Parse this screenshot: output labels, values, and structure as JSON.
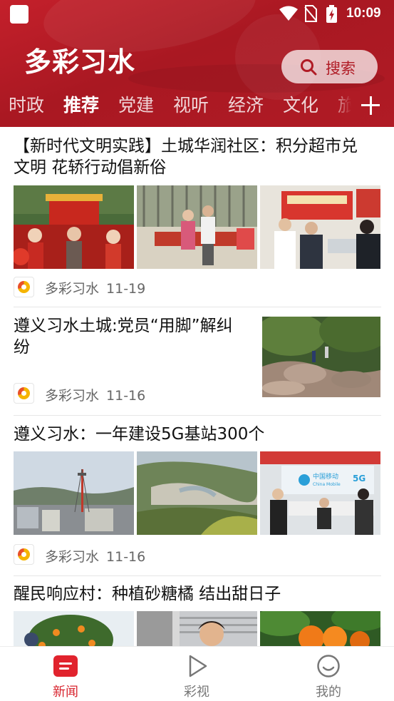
{
  "status_bar": {
    "time": "10:09"
  },
  "header": {
    "app_title": "多彩习水",
    "search_label": "搜索",
    "tabs": [
      "时政",
      "推荐",
      "党建",
      "视听",
      "经济",
      "文化",
      "旅"
    ],
    "active_tab": "推荐"
  },
  "articles": [
    {
      "title_line1": "【新时代文明实践】土城华润社区：积分超市兑",
      "title_line2": "文明 花轿行动倡新俗",
      "source": "多彩习水",
      "date": "11-19"
    },
    {
      "title_line1": "遵义习水土城:党员“用脚”解纠",
      "title_line2": "纷",
      "source": "多彩习水",
      "date": "11-16"
    },
    {
      "title_line1": "遵义习水：一年建设5G基站300个",
      "source": "多彩习水",
      "date": "11-16"
    },
    {
      "title_line1": "醒民响应村：种植砂糖橘 结出甜日子"
    }
  ],
  "photo_text": {
    "mobile_sign": "中国移动",
    "mobile_sign_en": "China Mobile",
    "five_g": "5G"
  },
  "bottom_nav": [
    {
      "label": "新闻",
      "icon": "news-icon",
      "active": true
    },
    {
      "label": "彩视",
      "icon": "play-icon",
      "active": false
    },
    {
      "label": "我的",
      "icon": "profile-icon",
      "active": false
    }
  ],
  "colors": {
    "brand_red": "#b01b25",
    "active_nav": "#d8242e"
  }
}
